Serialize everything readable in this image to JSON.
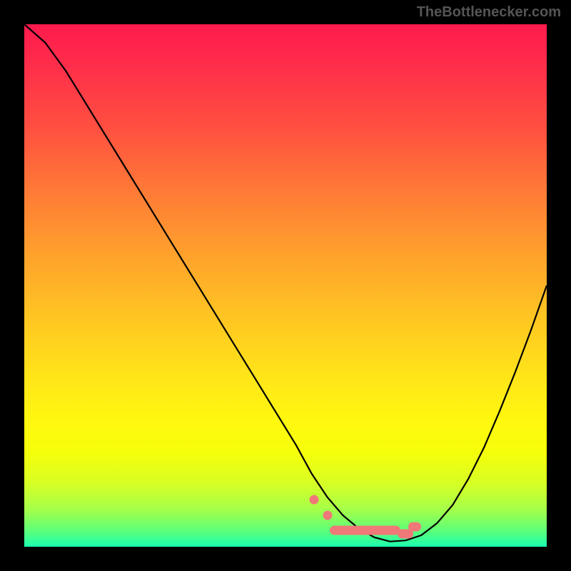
{
  "attribution": "TheBottlenecker.com",
  "chart_data": {
    "type": "line",
    "title": "",
    "xlabel": "",
    "ylabel": "",
    "xlim": [
      0,
      100
    ],
    "ylim": [
      0,
      100
    ],
    "series": [
      {
        "name": "curve",
        "x": [
          0,
          4,
          8,
          12,
          16,
          20,
          24,
          28,
          32,
          36,
          40,
          44,
          48,
          52,
          55,
          58,
          61,
          64,
          67,
          70,
          73,
          76,
          79,
          82,
          85,
          88,
          91,
          94,
          97,
          100
        ],
        "y": [
          100,
          96.5,
          91,
          84.5,
          78,
          71.5,
          65,
          58.5,
          52,
          45.5,
          39,
          32.5,
          26,
          19.5,
          14,
          9.5,
          6,
          3.5,
          1.8,
          1.0,
          1.2,
          2.2,
          4.5,
          8,
          13,
          19,
          26,
          33.5,
          41.5,
          50
        ]
      }
    ],
    "markers": {
      "dots": [
        {
          "x": 55.5,
          "y": 9
        },
        {
          "x": 58,
          "y": 6
        }
      ],
      "bar_segments": [
        {
          "x1": 58.5,
          "y": 3.2,
          "x2": 72
        },
        {
          "x1": 71.5,
          "y": 2.5,
          "x2": 74.5
        },
        {
          "x1": 73.5,
          "y": 3.8,
          "x2": 76
        }
      ]
    }
  }
}
